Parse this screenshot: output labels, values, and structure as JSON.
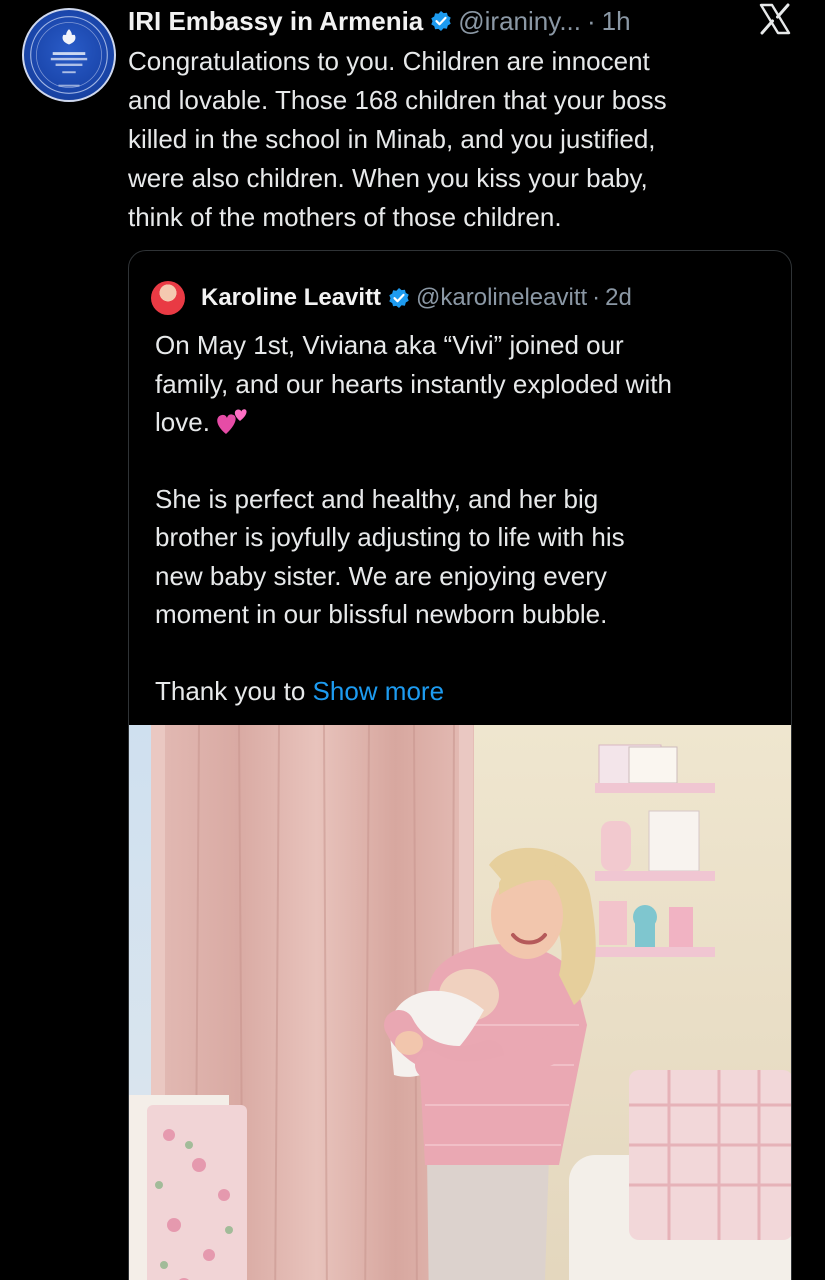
{
  "tweet": {
    "display_name": "IRI Embassy in Armenia",
    "handle": "@iraniny...",
    "separator": "·",
    "time": "1h",
    "lines": [
      "Congratulations to you. Children are innocent",
      "and lovable. Those 168 children that your boss",
      "killed in the school in Minab, and you justified,",
      "were also children. When you kiss your baby,",
      "think of the mothers of those children."
    ],
    "icons": {
      "verified": "verified-badge-icon",
      "close": "x-logo-icon",
      "avatar": "emblem-icon"
    }
  },
  "quote": {
    "display_name": "Karoline Leavitt",
    "handle": "@karolineleavitt",
    "separator": "·",
    "time": "2d",
    "para1": [
      "On May 1st, Viviana aka “Vivi” joined our",
      "family, and our hearts instantly exploded with",
      "love."
    ],
    "para2": [
      "She is perfect and healthy, and her big",
      "brother is joyfully adjusting to life with his",
      "new baby sister. We are enjoying every",
      "moment in our blissful newborn bubble."
    ],
    "para3_prefix": "Thank you to",
    "show_more": "Show more",
    "emoji": "two-hearts-icon"
  },
  "colors": {
    "background": "#000000",
    "text": "#e7e9ea",
    "secondary": "#8b98a5",
    "link": "#1d9bf0",
    "verified": "#1d9bf0"
  }
}
